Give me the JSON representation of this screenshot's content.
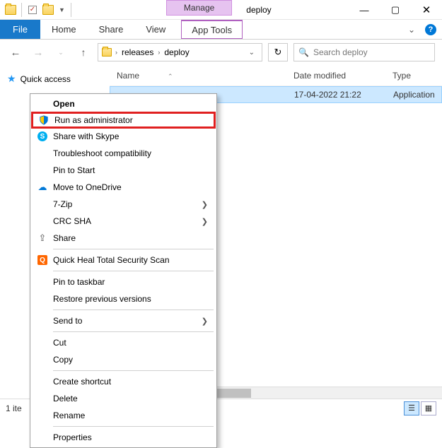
{
  "titlebar": {
    "manage_label": "Manage",
    "window_title": "deploy"
  },
  "ribbon": {
    "file": "File",
    "tabs": [
      "Home",
      "Share",
      "View"
    ],
    "context_tab": "App Tools"
  },
  "address": {
    "crumbs": [
      "releases",
      "deploy"
    ]
  },
  "search": {
    "placeholder": "Search deploy"
  },
  "sidebar": {
    "quick_access": "Quick access"
  },
  "columns": {
    "name": "Name",
    "date": "Date modified",
    "type": "Type"
  },
  "rows": [
    {
      "name": "",
      "date": "17-04-2022 21:22",
      "type": "Application"
    }
  ],
  "context_menu": {
    "open": "Open",
    "run_admin": "Run as administrator",
    "share_skype": "Share with Skype",
    "troubleshoot": "Troubleshoot compatibility",
    "pin_start": "Pin to Start",
    "onedrive": "Move to OneDrive",
    "sevenzip": "7-Zip",
    "crc": "CRC SHA",
    "share": "Share",
    "quickheal": "Quick Heal Total Security Scan",
    "pin_taskbar": "Pin to taskbar",
    "restore": "Restore previous versions",
    "sendto": "Send to",
    "cut": "Cut",
    "copy": "Copy",
    "shortcut": "Create shortcut",
    "delete": "Delete",
    "rename": "Rename",
    "properties": "Properties"
  },
  "statusbar": {
    "text": "1 ite"
  }
}
